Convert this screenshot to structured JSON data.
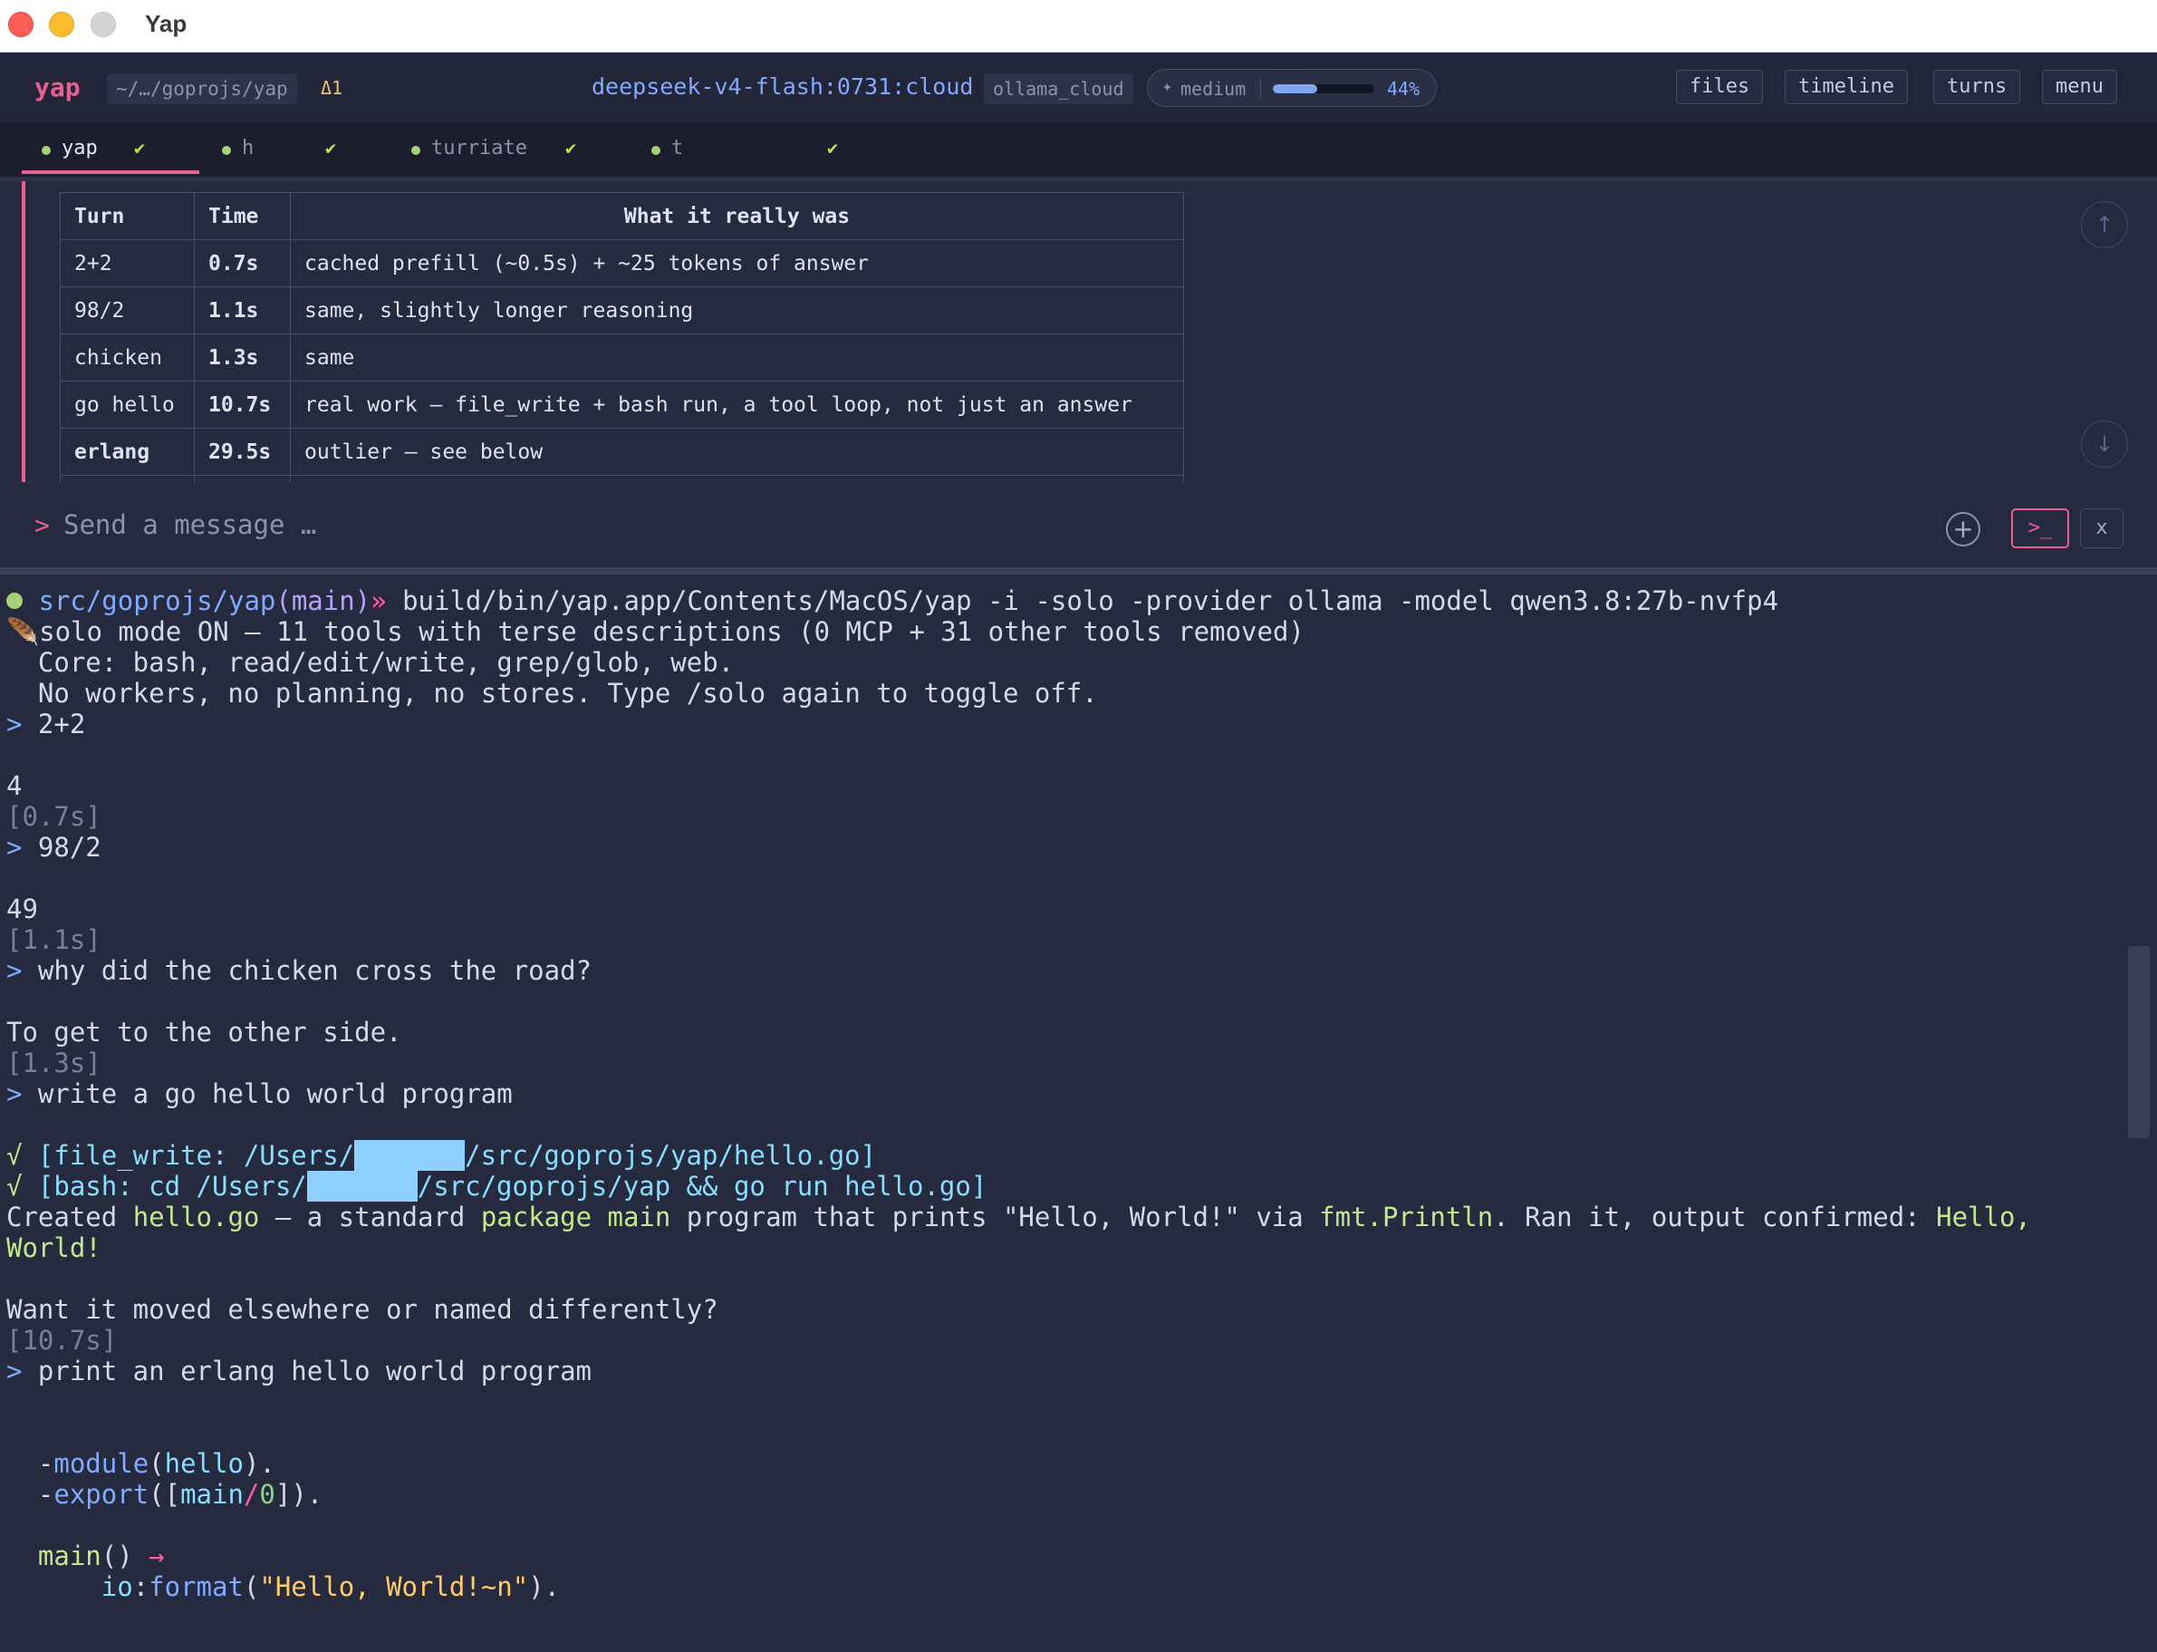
{
  "window": {
    "title": "Yap"
  },
  "header": {
    "brand": "yap",
    "path": "~/…/goprojs/yap",
    "delta": "Δ1",
    "model": "deepseek-v4-flash:0731:cloud",
    "provider": "ollama_cloud",
    "effort": {
      "icon": "sparkle-icon",
      "label": "medium",
      "percent_label": "44%",
      "fill_fraction": 0.44
    },
    "buttons": {
      "files": "files",
      "timeline": "timeline",
      "turns": "turns",
      "menu": "menu"
    }
  },
  "tabs": [
    {
      "label": "yap",
      "status": "✔",
      "active": true
    },
    {
      "label": "h",
      "status": "✔",
      "active": false
    },
    {
      "label": "turriate",
      "status": "✔",
      "active": false
    },
    {
      "label": "t",
      "status": "✔",
      "active": false
    }
  ],
  "transcript_table": {
    "headers": [
      "Turn",
      "Time",
      "What it really was"
    ],
    "rows": [
      [
        "2+2",
        "0.7s",
        "cached prefill (~0.5s) + ~25 tokens of answer"
      ],
      [
        "98/2",
        "1.1s",
        "same, slightly longer reasoning"
      ],
      [
        "chicken",
        "1.3s",
        "same"
      ],
      [
        "go hello",
        "10.7s",
        "real work — file_write + bash run, a tool loop, not just an answer"
      ],
      [
        "erlang",
        "29.5s",
        "outlier — see below"
      ]
    ]
  },
  "input": {
    "prompt_symbol": ">",
    "placeholder": "Send a message …",
    "value": "",
    "add_icon": "+",
    "terminal_toggle": ">_",
    "close_label": "x"
  },
  "terminal": {
    "lines": {
      "cwd": "src/goprojs/yap",
      "branch": "(main)",
      "arrow": "»",
      "command": " build/bin/yap.app/Contents/MacOS/yap -i -solo -provider ollama -model qwen3.8:27b-nvfp4",
      "solo_icon": "🪶",
      "solo_on": "solo mode ON — 11 tools with terse descriptions (0 MCP + 31 other tools removed)",
      "core": "  Core: bash, read/edit/write, grep/glob, web.",
      "noworkers": "  No workers, no planning, no stores. Type /solo again to toggle off.",
      "prompt_marker": ">",
      "q1": " 2+2",
      "a1": "4",
      "t1": "[0.7s]",
      "q2": " 98/2",
      "a2": "49",
      "t2": "[1.1s]",
      "q3": " why did the chicken cross the road?",
      "a3": "To get to the other side.",
      "t3": "[1.3s]",
      "q4": " write a go hello world program",
      "check": "√",
      "fw_pre": " [file_write: /Users/",
      "fw_post": "/src/goprojs/yap/hello.go]",
      "bash_pre": " [bash: cd /Users/",
      "bash_post": "/src/goprojs/yap && go run hello.go]",
      "created_1": "Created ",
      "created_file": "hello.go",
      "created_2": " — a standard ",
      "created_pkg": "package main",
      "created_3": " program that prints \"Hello, World!\" via ",
      "created_fn": "fmt.Println",
      "created_4": ". Ran it, output confirmed: ",
      "created_out1": "Hello,",
      "created_out2": "World!",
      "followup": "Want it moved elsewhere or named differently?",
      "t4": "[10.7s]",
      "q5": " print an erlang hello world program",
      "erl_dash1": "  -",
      "erl_module_kw": "module",
      "erl_paren_open": "(",
      "erl_module_name": "hello",
      "erl_paren_close": ").",
      "erl_dash2": "  -",
      "erl_export_kw": "export",
      "erl_export_open": "([",
      "erl_export_fn": "main",
      "erl_slash": "/",
      "erl_arity": "0",
      "erl_export_close": "]).",
      "erl_main": "  main",
      "erl_main_parens": "() ",
      "erl_arrow": "→",
      "erl_io_indent": "      ",
      "erl_io": "io",
      "erl_colon": ":",
      "erl_format": "format",
      "erl_fmt_open": "(",
      "erl_string": "\"Hello, World!~n\"",
      "erl_fmt_close": ")."
    }
  },
  "colors": {
    "accent": "#e8608f",
    "background": "#262a3f",
    "link_blue": "#82aaff",
    "success_green": "#a6d174",
    "redaction": "#8ed0ff"
  }
}
